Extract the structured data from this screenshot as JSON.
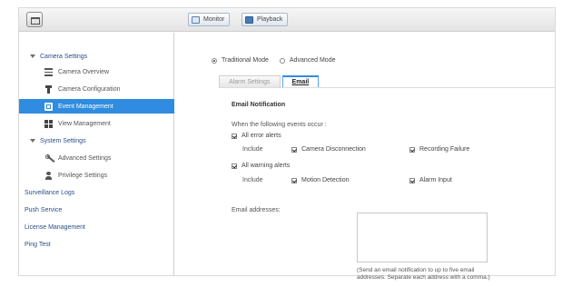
{
  "toolbar": {
    "monitor_label": "Monitor",
    "playback_label": "Playback"
  },
  "sidebar": {
    "camera_settings": {
      "label": "Camera Settings",
      "children": [
        "Camera Overview",
        "Camera Configuration",
        "Event Management",
        "View Management"
      ]
    },
    "system_settings": {
      "label": "System Settings",
      "children": [
        "Advanced Settings",
        "Privilege Settings"
      ]
    },
    "links": [
      "Surveillance Logs",
      "Push Service",
      "License Management",
      "Ping Test"
    ],
    "selected": "Event Management"
  },
  "main": {
    "modes": [
      "Traditional Mode",
      "Advanced Mode"
    ],
    "selected_mode": "Traditional Mode",
    "tabs": [
      "Alarm Settings",
      "Email"
    ],
    "active_tab": "Email",
    "section_title": "Email Notification",
    "intro": "When the following events occur :",
    "error_alerts": {
      "label": "All error alerts",
      "include_label": "Include",
      "options": [
        "Camera Disconnection",
        "Recording Failure"
      ]
    },
    "warning_alerts": {
      "label": "All warning alerts",
      "include_label": "Include",
      "options": [
        "Motion Detection",
        "Alarm Input"
      ]
    },
    "email_label": "Email addresses:",
    "email_value": "",
    "note_line1": "(Send an email notification to up to five email",
    "note_line2": "addresses. Separate each address with a comma.)"
  },
  "colors": {
    "accent": "#2f8ce0",
    "link": "#2a4e86"
  }
}
